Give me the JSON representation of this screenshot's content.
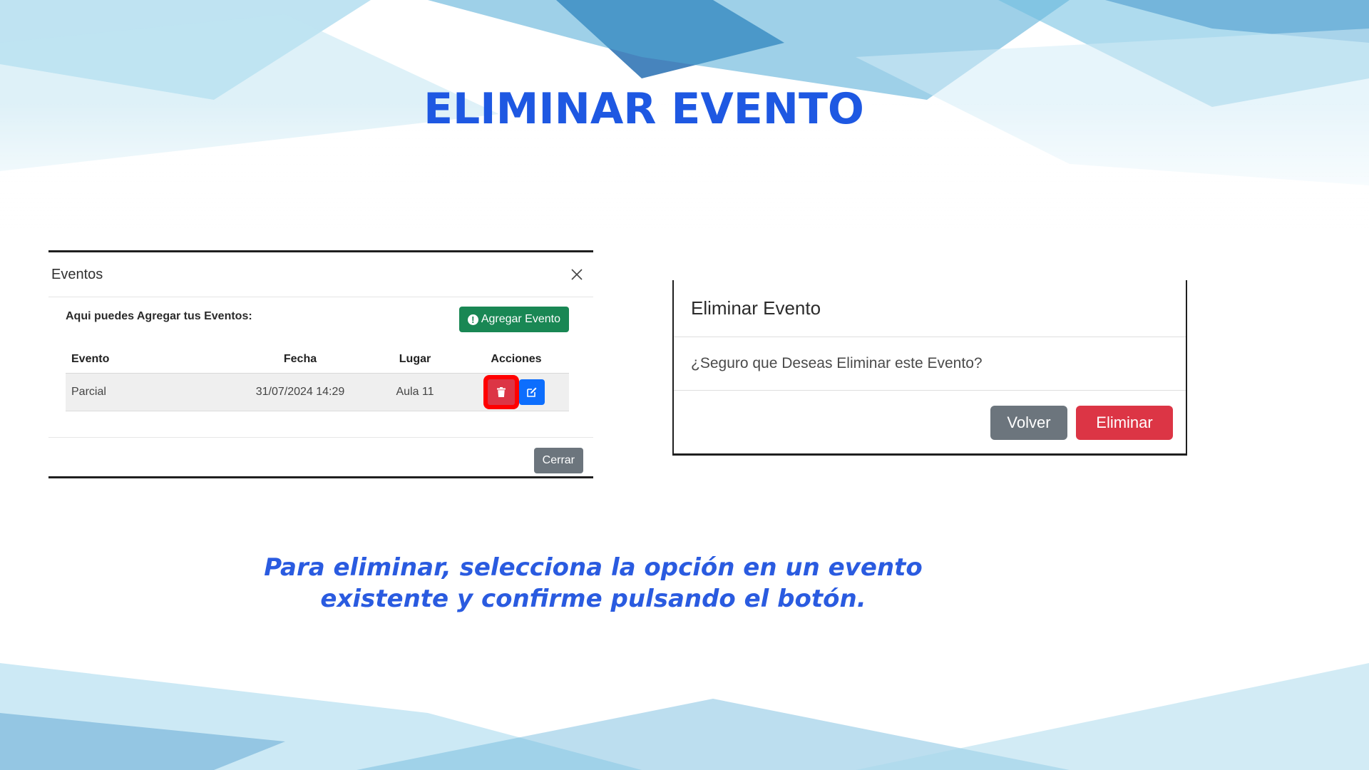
{
  "slide": {
    "title": "ELIMINAR EVENTO",
    "caption_line1": "Para eliminar, selecciona la opción en un evento",
    "caption_line2": "existente y confirme pulsando el botón."
  },
  "events_modal": {
    "title": "Eventos",
    "intro": "Aqui puedes Agregar tus Eventos:",
    "add_button": "Agregar Evento",
    "columns": [
      "Evento",
      "Fecha",
      "Lugar",
      "Acciones"
    ],
    "rows": [
      {
        "evento": "Parcial",
        "fecha": "31/07/2024 14:29",
        "lugar": "Aula 11"
      }
    ],
    "close_button": "Cerrar"
  },
  "confirm_modal": {
    "title": "Eliminar Evento",
    "message": "¿Seguro que Deseas Eliminar este Evento?",
    "back_button": "Volver",
    "delete_button": "Eliminar"
  },
  "colors": {
    "title_blue": "#1e58e2",
    "success_green": "#198754",
    "danger_red": "#dc3545",
    "primary_blue": "#0d6efd",
    "secondary_gray": "#6c757d",
    "highlight_red": "#ff0000"
  },
  "icons": [
    "close-icon",
    "plus-circle-icon",
    "trash-icon",
    "edit-icon"
  ]
}
